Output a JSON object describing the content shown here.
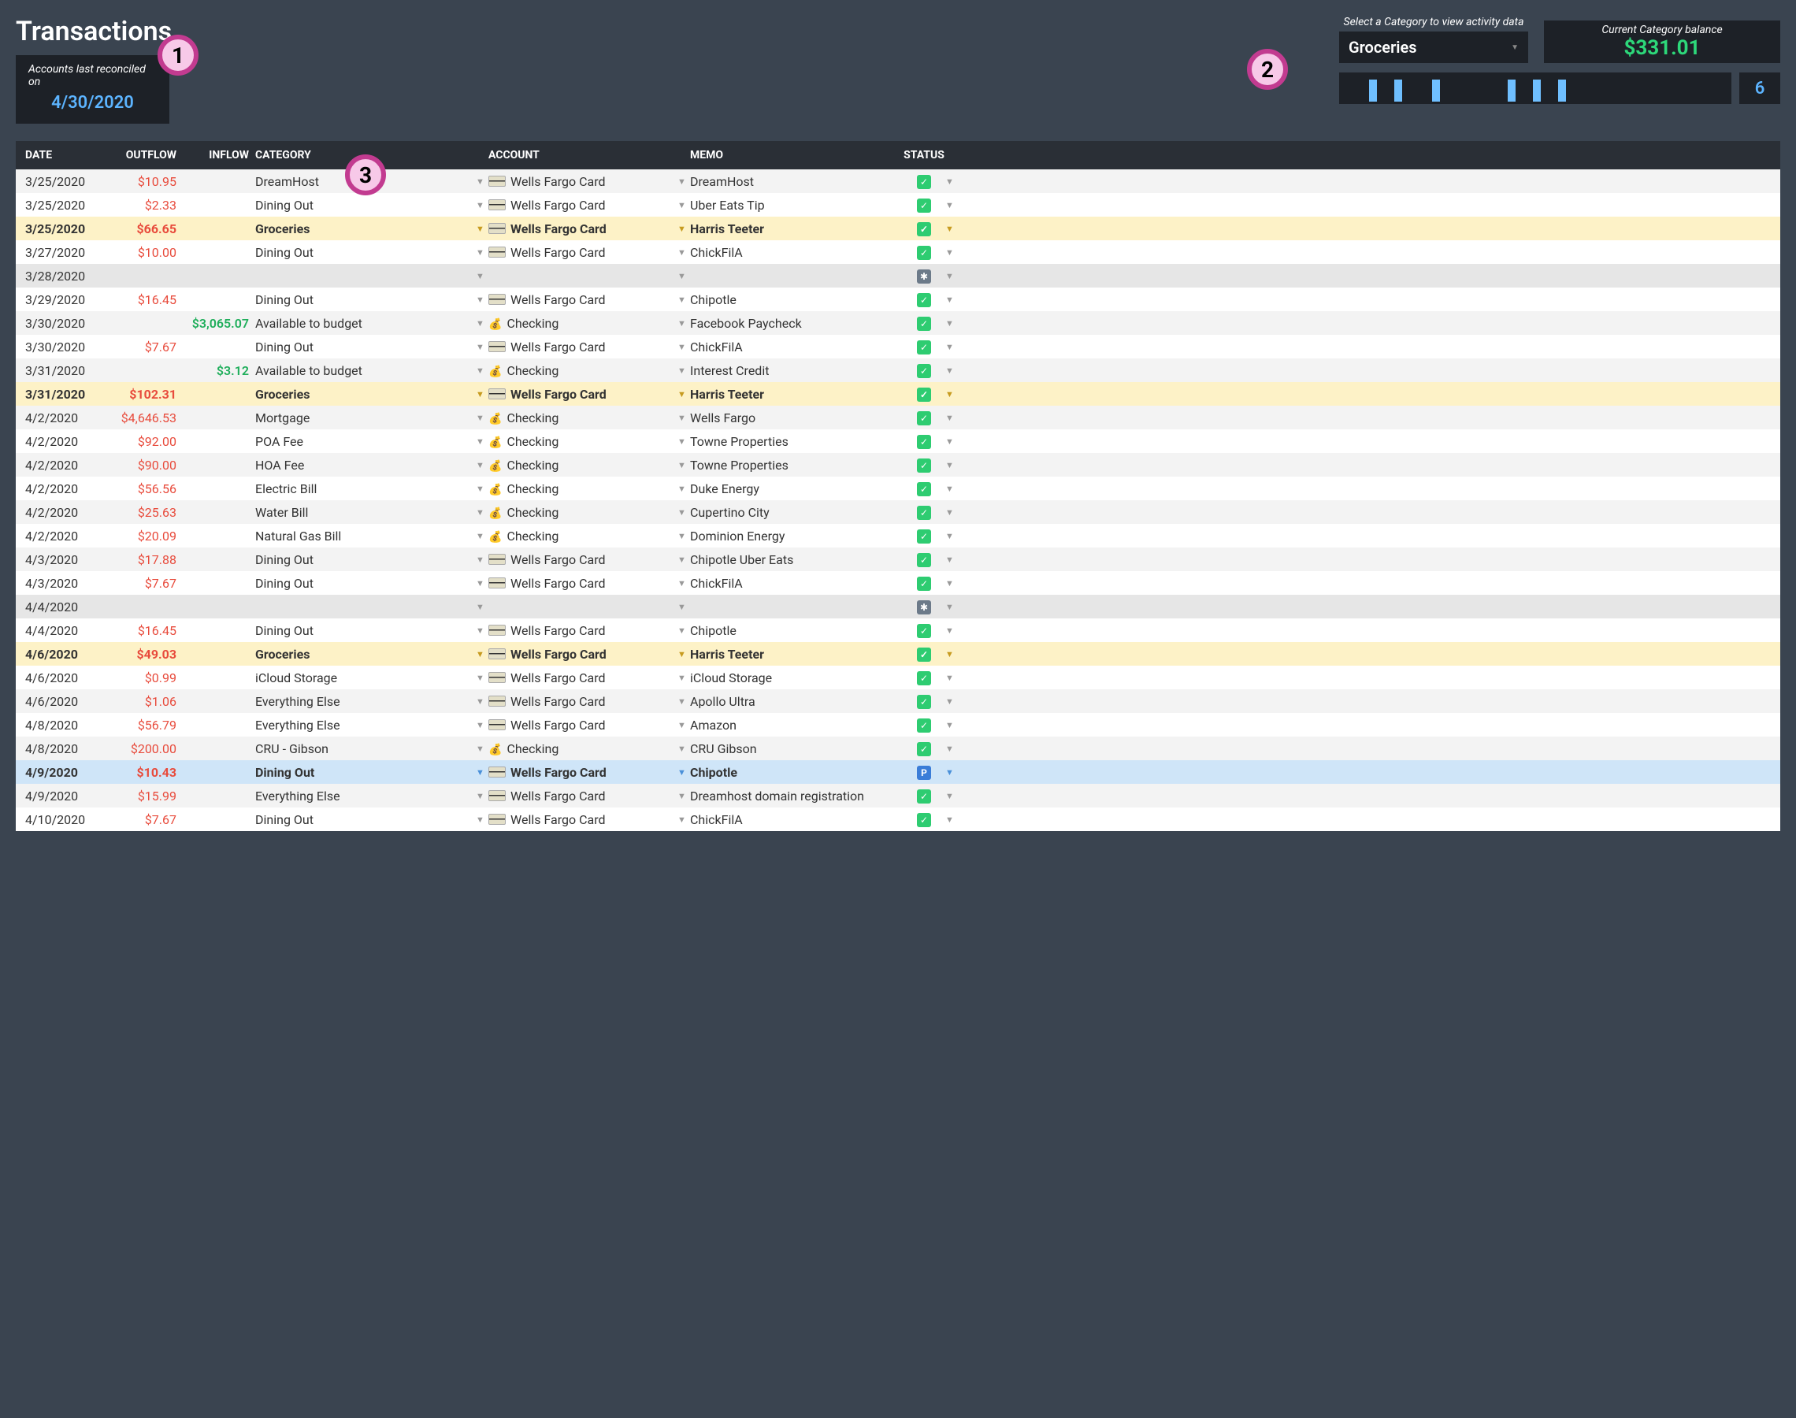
{
  "title": "Transactions",
  "reconcile": {
    "label": "Accounts last reconciled on",
    "date": "4/30/2020"
  },
  "category_panel": {
    "select_label": "Select a Category to view activity data",
    "selected": "Groceries",
    "balance_label": "Current Category balance",
    "balance": "$331.01",
    "count": "6",
    "spark": [
      0,
      0,
      28,
      0,
      28,
      0,
      0,
      28,
      0,
      0,
      0,
      0,
      0,
      28,
      0,
      28,
      0,
      28
    ]
  },
  "annotations": {
    "a1": "1",
    "a2": "2",
    "a3": "3"
  },
  "columns": {
    "date": "DATE",
    "outflow": "OUTFLOW",
    "inflow": "INFLOW",
    "category": "CATEGORY",
    "account": "ACCOUNT",
    "memo": "MEMO",
    "status": "STATUS"
  },
  "accounts": {
    "card": "Wells Fargo Card",
    "checking": "Checking"
  },
  "status_labels": {
    "ok": "✓",
    "star": "✱",
    "p": "P"
  },
  "rows": [
    {
      "date": "3/25/2020",
      "outflow": "$10.95",
      "inflow": "",
      "category": "DreamHost",
      "acct": "card",
      "memo": "DreamHost",
      "status": "ok",
      "style": "alt0"
    },
    {
      "date": "3/25/2020",
      "outflow": "$2.33",
      "inflow": "",
      "category": "Dining Out",
      "acct": "card",
      "memo": "Uber Eats Tip",
      "status": "ok",
      "style": "alt1"
    },
    {
      "date": "3/25/2020",
      "outflow": "$66.65",
      "inflow": "",
      "category": "Groceries",
      "acct": "card",
      "memo": "Harris Teeter",
      "status": "ok",
      "style": "hl-yellow"
    },
    {
      "date": "3/27/2020",
      "outflow": "$10.00",
      "inflow": "",
      "category": "Dining Out",
      "acct": "card",
      "memo": "ChickFilA",
      "status": "ok",
      "style": "alt1"
    },
    {
      "date": "3/28/2020",
      "outflow": "",
      "inflow": "",
      "category": "",
      "acct": "",
      "memo": "",
      "status": "star",
      "style": "hl-grey"
    },
    {
      "date": "3/29/2020",
      "outflow": "$16.45",
      "inflow": "",
      "category": "Dining Out",
      "acct": "card",
      "memo": "Chipotle",
      "status": "ok",
      "style": "alt1"
    },
    {
      "date": "3/30/2020",
      "outflow": "",
      "inflow": "$3,065.07",
      "category": "Available to budget",
      "acct": "checking",
      "memo": "Facebook Paycheck",
      "status": "ok",
      "style": "alt0"
    },
    {
      "date": "3/30/2020",
      "outflow": "$7.67",
      "inflow": "",
      "category": "Dining Out",
      "acct": "card",
      "memo": "ChickFilA",
      "status": "ok",
      "style": "alt1"
    },
    {
      "date": "3/31/2020",
      "outflow": "",
      "inflow": "$3.12",
      "category": "Available to budget",
      "acct": "checking",
      "memo": "Interest Credit",
      "status": "ok",
      "style": "alt0"
    },
    {
      "date": "3/31/2020",
      "outflow": "$102.31",
      "inflow": "",
      "category": "Groceries",
      "acct": "card",
      "memo": "Harris Teeter",
      "status": "ok",
      "style": "hl-yellow"
    },
    {
      "date": "4/2/2020",
      "outflow": "$4,646.53",
      "inflow": "",
      "category": "Mortgage",
      "acct": "checking",
      "memo": "Wells Fargo",
      "status": "ok",
      "style": "alt0"
    },
    {
      "date": "4/2/2020",
      "outflow": "$92.00",
      "inflow": "",
      "category": "POA Fee",
      "acct": "checking",
      "memo": "Towne Properties",
      "status": "ok",
      "style": "alt1"
    },
    {
      "date": "4/2/2020",
      "outflow": "$90.00",
      "inflow": "",
      "category": "HOA Fee",
      "acct": "checking",
      "memo": "Towne Properties",
      "status": "ok",
      "style": "alt0"
    },
    {
      "date": "4/2/2020",
      "outflow": "$56.56",
      "inflow": "",
      "category": "Electric Bill",
      "acct": "checking",
      "memo": "Duke Energy",
      "status": "ok",
      "style": "alt1"
    },
    {
      "date": "4/2/2020",
      "outflow": "$25.63",
      "inflow": "",
      "category": "Water Bill",
      "acct": "checking",
      "memo": "Cupertino City",
      "status": "ok",
      "style": "alt0"
    },
    {
      "date": "4/2/2020",
      "outflow": "$20.09",
      "inflow": "",
      "category": "Natural Gas Bill",
      "acct": "checking",
      "memo": "Dominion Energy",
      "status": "ok",
      "style": "alt1"
    },
    {
      "date": "4/3/2020",
      "outflow": "$17.88",
      "inflow": "",
      "category": "Dining Out",
      "acct": "card",
      "memo": "Chipotle Uber Eats",
      "status": "ok",
      "style": "alt0"
    },
    {
      "date": "4/3/2020",
      "outflow": "$7.67",
      "inflow": "",
      "category": "Dining Out",
      "acct": "card",
      "memo": "ChickFilA",
      "status": "ok",
      "style": "alt1"
    },
    {
      "date": "4/4/2020",
      "outflow": "",
      "inflow": "",
      "category": "",
      "acct": "",
      "memo": "",
      "status": "star",
      "style": "hl-grey"
    },
    {
      "date": "4/4/2020",
      "outflow": "$16.45",
      "inflow": "",
      "category": "Dining Out",
      "acct": "card",
      "memo": "Chipotle",
      "status": "ok",
      "style": "alt1"
    },
    {
      "date": "4/6/2020",
      "outflow": "$49.03",
      "inflow": "",
      "category": "Groceries",
      "acct": "card",
      "memo": "Harris Teeter",
      "status": "ok",
      "style": "hl-yellow"
    },
    {
      "date": "4/6/2020",
      "outflow": "$0.99",
      "inflow": "",
      "category": "iCloud Storage",
      "acct": "card",
      "memo": "iCloud Storage",
      "status": "ok",
      "style": "alt1"
    },
    {
      "date": "4/6/2020",
      "outflow": "$1.06",
      "inflow": "",
      "category": "Everything Else",
      "acct": "card",
      "memo": "Apollo Ultra",
      "status": "ok",
      "style": "alt0"
    },
    {
      "date": "4/8/2020",
      "outflow": "$56.79",
      "inflow": "",
      "category": "Everything Else",
      "acct": "card",
      "memo": "Amazon",
      "status": "ok",
      "style": "alt1"
    },
    {
      "date": "4/8/2020",
      "outflow": "$200.00",
      "inflow": "",
      "category": "CRU - Gibson",
      "acct": "checking",
      "memo": "CRU Gibson",
      "status": "ok",
      "style": "alt0"
    },
    {
      "date": "4/9/2020",
      "outflow": "$10.43",
      "inflow": "",
      "category": "Dining Out",
      "acct": "card",
      "memo": "Chipotle",
      "status": "p",
      "style": "hl-blue"
    },
    {
      "date": "4/9/2020",
      "outflow": "$15.99",
      "inflow": "",
      "category": "Everything Else",
      "acct": "card",
      "memo": "Dreamhost domain registration",
      "status": "ok",
      "style": "alt0"
    },
    {
      "date": "4/10/2020",
      "outflow": "$7.67",
      "inflow": "",
      "category": "Dining Out",
      "acct": "card",
      "memo": "ChickFilA",
      "status": "ok",
      "style": "alt1"
    }
  ]
}
